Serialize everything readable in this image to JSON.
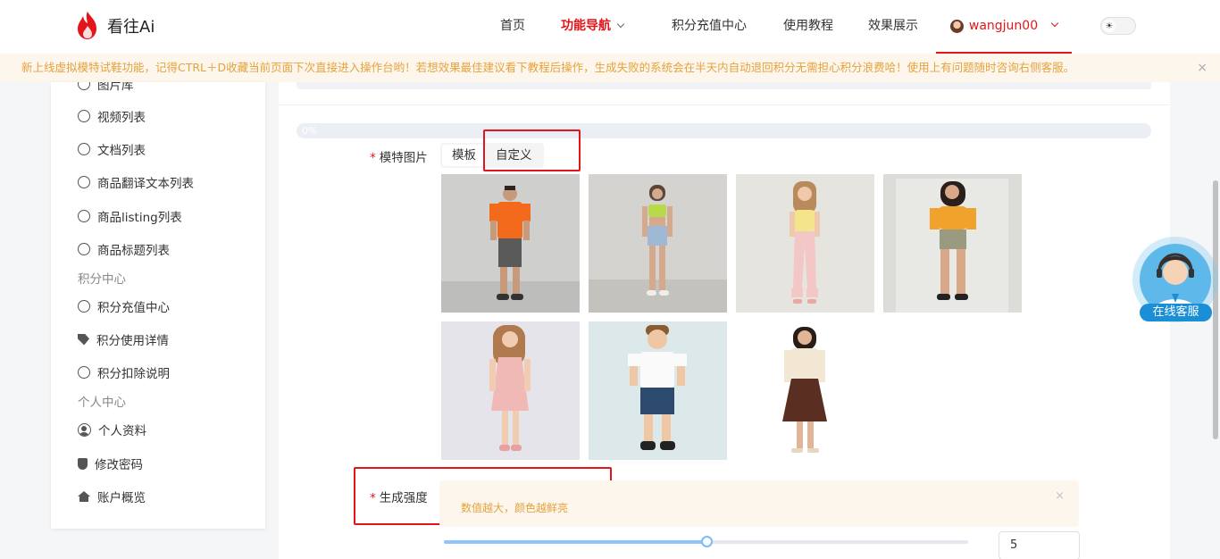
{
  "header": {
    "logo_text": "看往Ai",
    "nav": [
      {
        "label": "首页"
      },
      {
        "label": "功能导航",
        "active": true
      },
      {
        "label": "积分充值中心"
      },
      {
        "label": "使用教程"
      },
      {
        "label": "效果展示"
      }
    ],
    "username": "wangjun00",
    "theme_icon": "sun-icon"
  },
  "notice": {
    "text": "新上线虚拟模特试鞋功能，记得CTRL＋D收藏当前页面下次直接进入操作台哟！若想效果最佳建议看下教程后操作，生成失败的系统会在半天内自动退回积分无需担心积分浪费哈！使用上有问题随时咨询右侧客服。",
    "close": "×"
  },
  "sidebar": {
    "partial_item": "图片库",
    "items_top": [
      "视频列表",
      "文档列表",
      "商品翻译文本列表",
      "商品listing列表",
      "商品标题列表"
    ],
    "group_points": "积分中心",
    "items_points": [
      {
        "label": "积分充值中心",
        "icon": "circle-icon"
      },
      {
        "label": "积分使用详情",
        "icon": "tag-icon"
      },
      {
        "label": "积分扣除说明",
        "icon": "circle-icon"
      }
    ],
    "group_personal": "个人中心",
    "items_personal": [
      {
        "label": "个人资料",
        "icon": "user-icon"
      },
      {
        "label": "修改密码",
        "icon": "shield-icon"
      },
      {
        "label": "账户概览",
        "icon": "home-icon"
      }
    ]
  },
  "main": {
    "progress_text": "0%",
    "model_label": "模特图片",
    "tabs": [
      "模板",
      "自定义"
    ],
    "strength_label": "生成强度",
    "alert_text": "数值越大，颜色越鲜亮",
    "alert_close": "×",
    "slider_value_fraction": 0.5,
    "input_value": "5"
  },
  "service": {
    "label": "在线客服"
  },
  "colors": {
    "accent": "#e4141b",
    "notice_text": "#e6a23c",
    "notice_bg": "#fdf6ec",
    "slider": "#8ec5fc"
  }
}
